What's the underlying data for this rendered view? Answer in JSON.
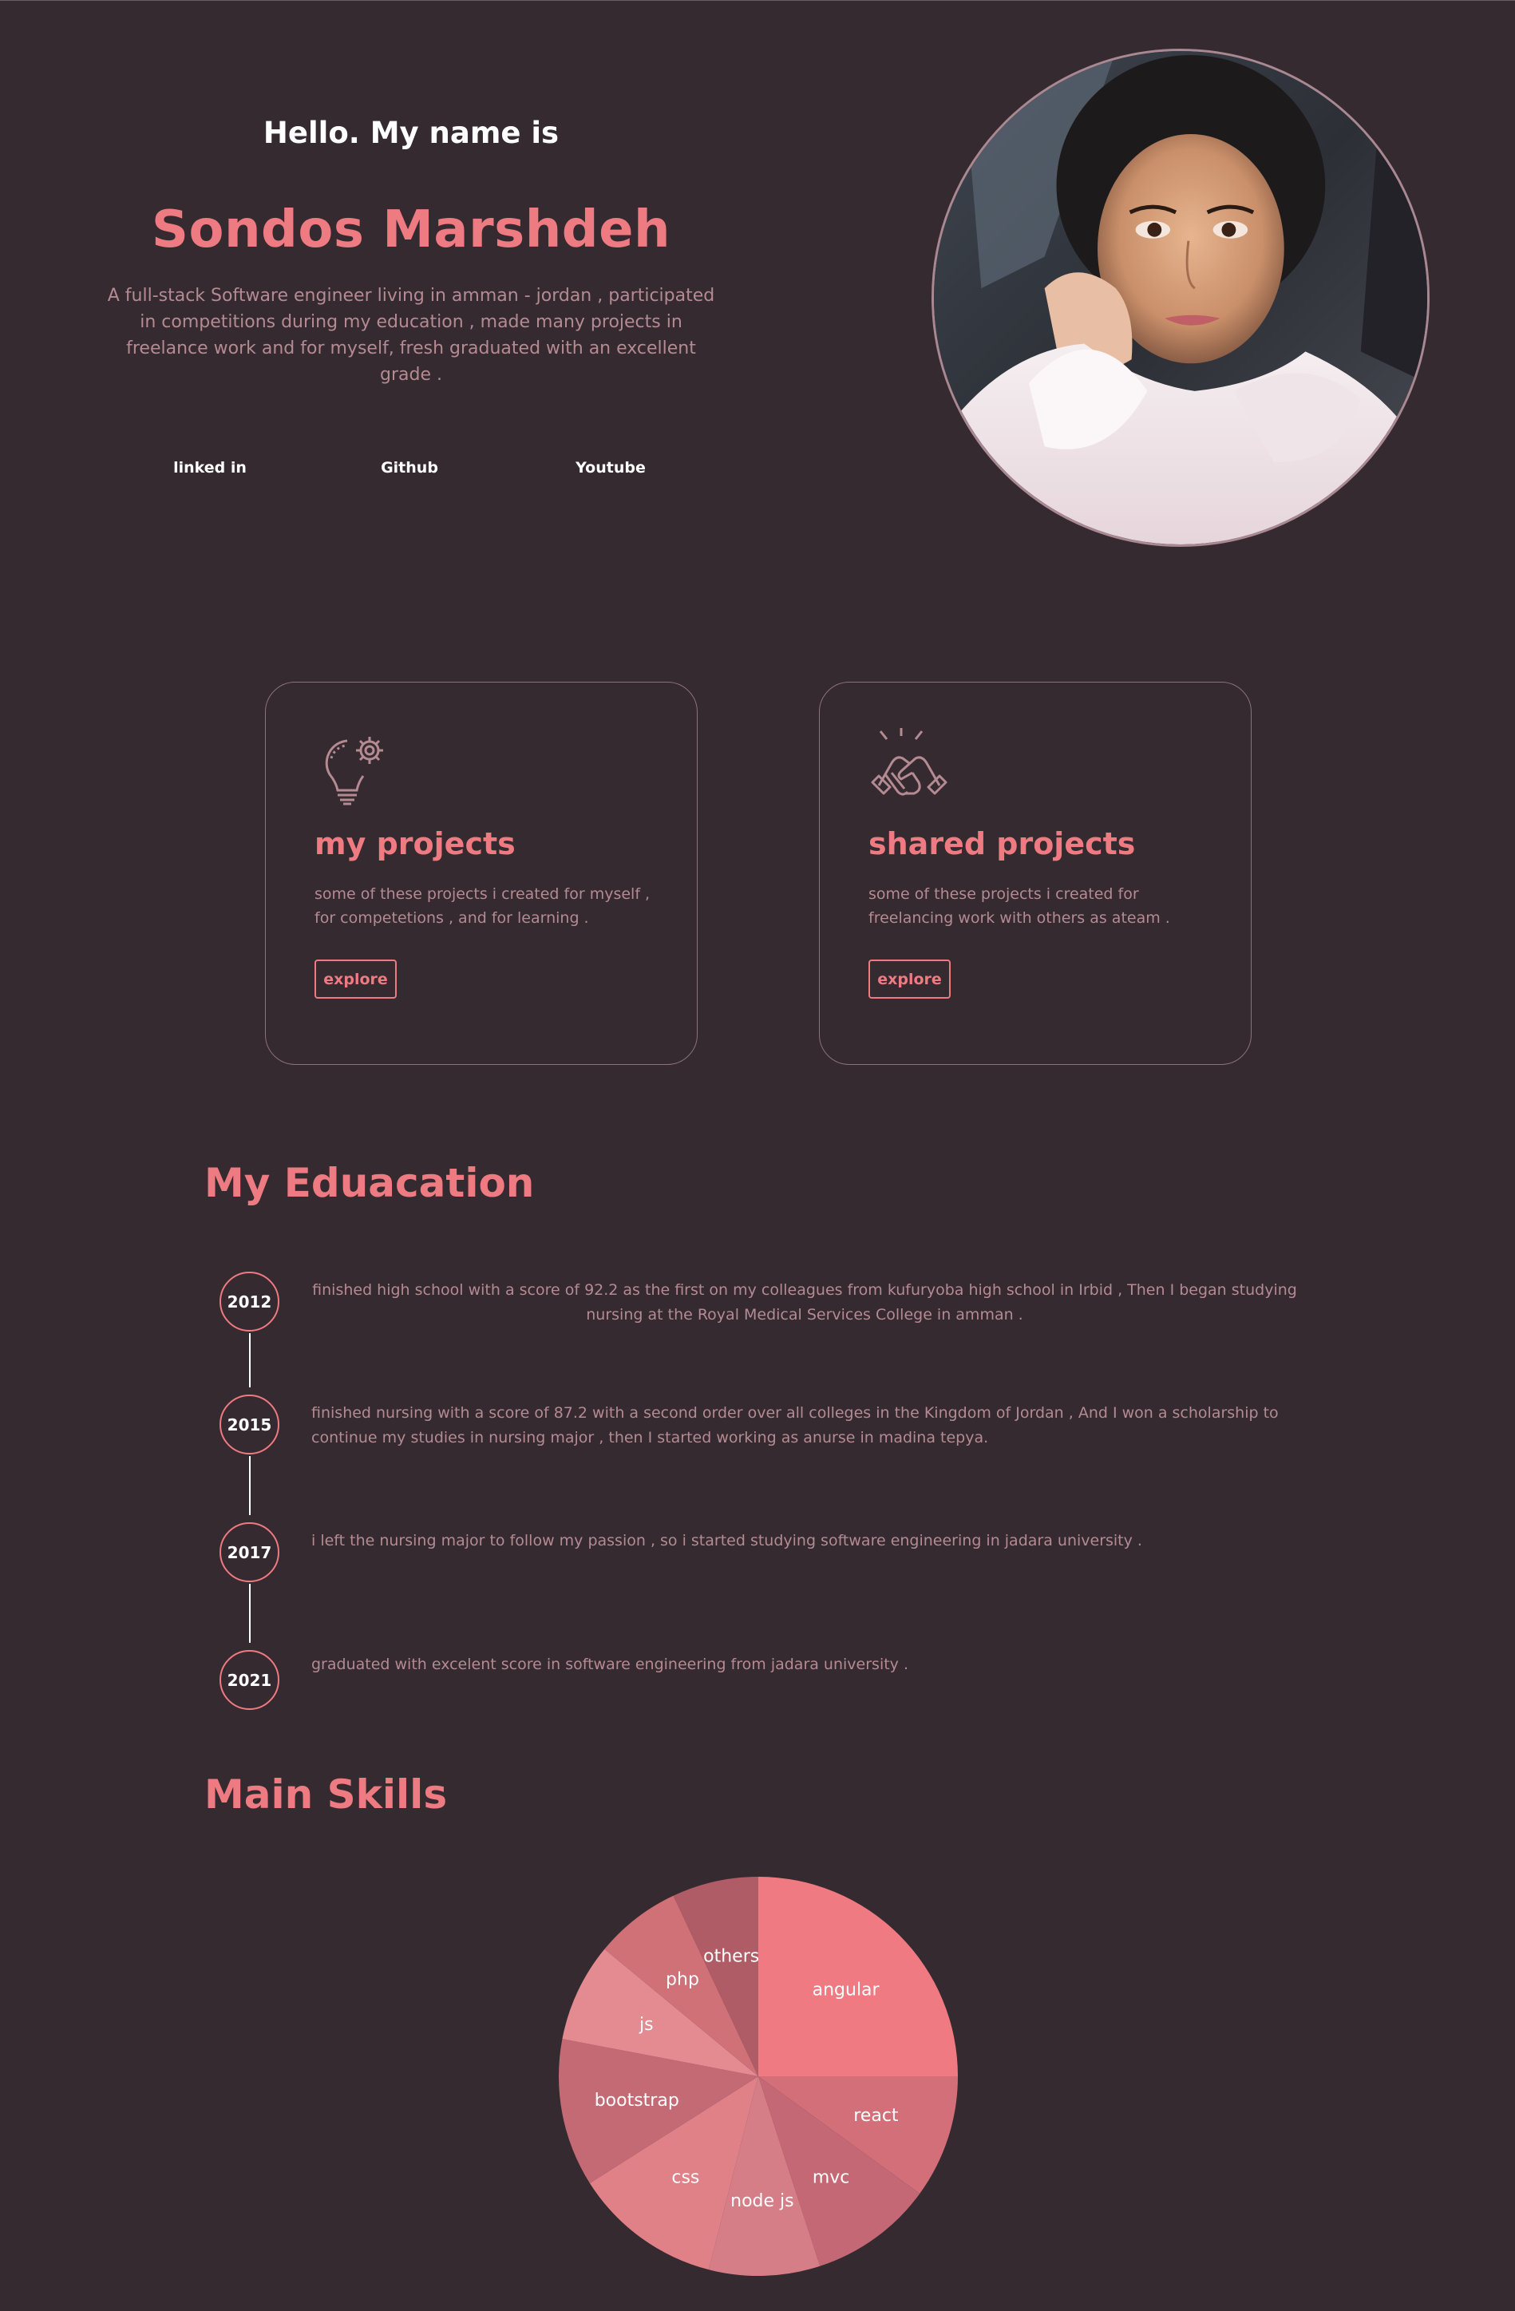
{
  "hero": {
    "greeting": "Hello. My name is",
    "name": "Sondos Marshdeh",
    "bio": "A full-stack Software engineer living in amman - jordan , participated in competitions during my education , made many projects in freelance work and for myself, fresh graduated with an excellent grade ."
  },
  "social": [
    {
      "label": "linked in"
    },
    {
      "label": "Github"
    },
    {
      "label": "Youtube"
    }
  ],
  "cards": [
    {
      "icon": "lightbulb-gear-icon",
      "title": "my projects",
      "description": "some of these projects i created for myself , for competetions , and for learning .",
      "button": "explore"
    },
    {
      "icon": "handshake-icon",
      "title": "shared projects",
      "description": "some of these projects i created for freelancing work with others as ateam .",
      "button": "explore"
    }
  ],
  "education": {
    "title": "My Eduacation",
    "items": [
      {
        "year": "2012",
        "text": "finished high school with a score of 92.2 as the first on my colleagues from kufuryoba high school in Irbid , Then I began studying nursing at the Royal Medical Services College in amman ."
      },
      {
        "year": "2015",
        "text": "finished nursing with a score of 87.2 with a second order over all colleges in the Kingdom of Jordan , And I won a scholarship to continue my studies in nursing major , then I started working as anurse in madina tepya."
      },
      {
        "year": "2017",
        "text": "i left the nursing major to follow my passion , so i started studying software engineering in jadara university ."
      },
      {
        "year": "2021",
        "text": "graduated with excelent score in software engineering from jadara university ."
      }
    ]
  },
  "skills": {
    "title": "Main Skills"
  },
  "colors": {
    "background": "#352a2f",
    "accent": "#ee7a82",
    "muted_text": "#b48a93",
    "card_border": "#8c727a"
  },
  "chart_data": {
    "type": "pie",
    "title": "",
    "slices": [
      {
        "label": "angular",
        "value": 25,
        "color": "#f07a82"
      },
      {
        "label": "react",
        "value": 10,
        "color": "#d36f79"
      },
      {
        "label": "mvc",
        "value": 10,
        "color": "#c36874"
      },
      {
        "label": "node js",
        "value": 9,
        "color": "#d57e88"
      },
      {
        "label": "css",
        "value": 12,
        "color": "#e08087"
      },
      {
        "label": "bootstrap",
        "value": 12,
        "color": "#c46a75"
      },
      {
        "label": "js",
        "value": 8,
        "color": "#e48a91"
      },
      {
        "label": "php",
        "value": 7,
        "color": "#d07178"
      },
      {
        "label": "others",
        "value": 7,
        "color": "#b05c66"
      }
    ]
  }
}
